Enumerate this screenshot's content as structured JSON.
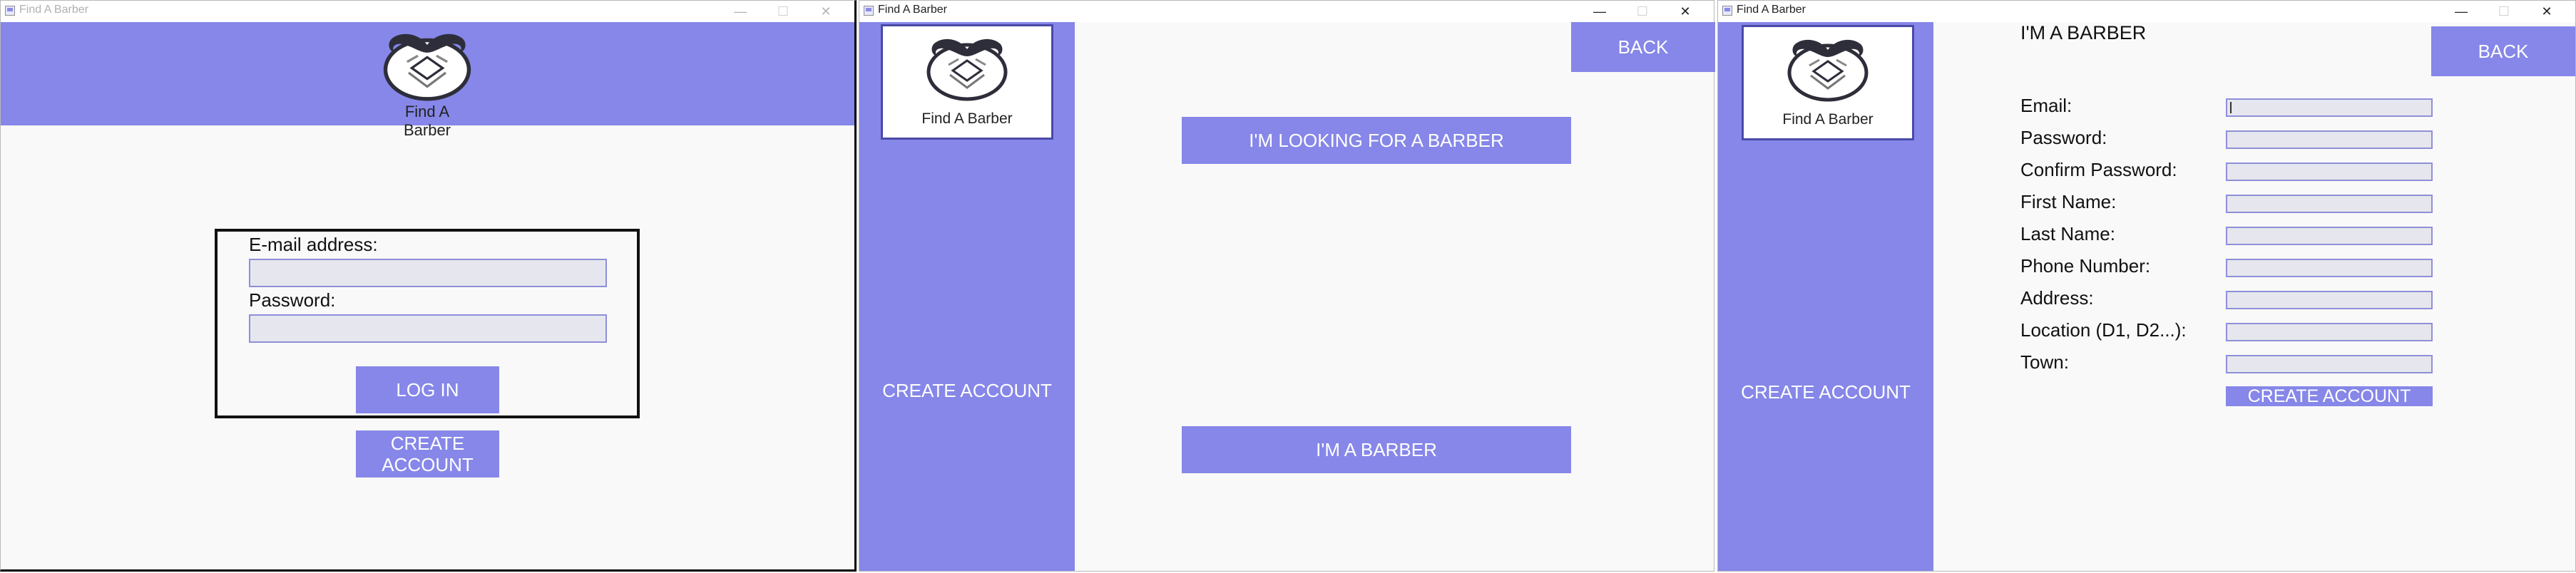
{
  "window_title": "Find A Barber",
  "titlebar_buttons": {
    "minimize": "—",
    "maximize": "☐",
    "close": "✕"
  },
  "login": {
    "logo_text": "Find A Barber",
    "email_label": "E-mail address:",
    "password_label": "Password:",
    "email_value": "",
    "password_value": "",
    "login_button": "LOG IN",
    "create_account_button_line1": "CREATE",
    "create_account_button_line2": "ACCOUNT"
  },
  "choose": {
    "logo_text": "Find A Barber",
    "sidebar_label": "CREATE ACCOUNT",
    "back_button": "BACK",
    "customer_button": "I'M LOOKING FOR A BARBER",
    "barber_button": "I'M A BARBER"
  },
  "barber_form": {
    "logo_text": "Find A Barber",
    "sidebar_label": "CREATE ACCOUNT",
    "heading": "I'M A BARBER",
    "back_button": "BACK",
    "fields": [
      {
        "label": "Email:",
        "value": ""
      },
      {
        "label": "Password:",
        "value": ""
      },
      {
        "label": "Confirm Password:",
        "value": ""
      },
      {
        "label": "First Name:",
        "value": ""
      },
      {
        "label": "Last Name:",
        "value": ""
      },
      {
        "label": "Phone Number:",
        "value": ""
      },
      {
        "label": "Address:",
        "value": ""
      },
      {
        "label": "Location (D1, D2...):",
        "value": ""
      },
      {
        "label": "Town:",
        "value": ""
      }
    ],
    "submit_button": "CREATE ACCOUNT"
  },
  "colors": {
    "accent": "#8687e8",
    "field_bg": "#e6e6ee",
    "window_bg": "#f9f9f9"
  }
}
